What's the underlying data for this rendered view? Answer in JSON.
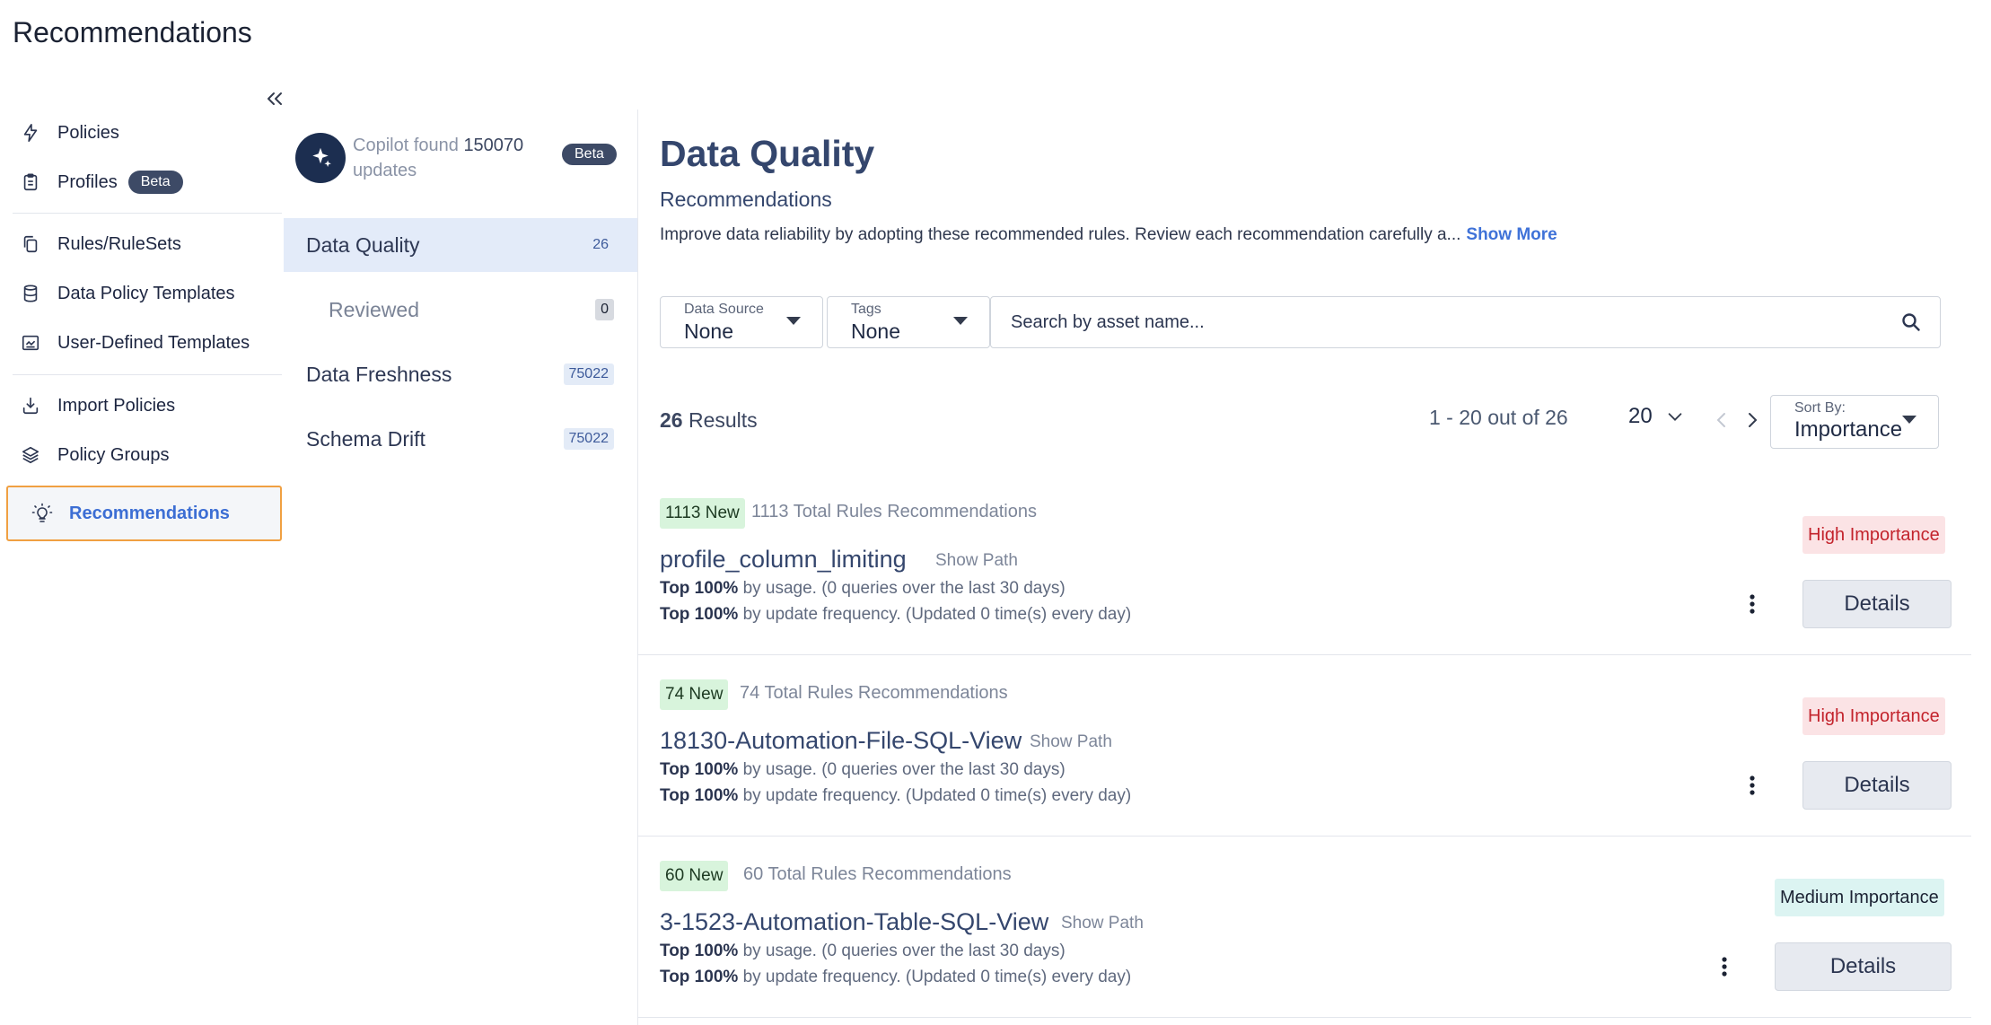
{
  "page": {
    "title": "Recommendations"
  },
  "sidebar": {
    "items": [
      {
        "label": "Policies",
        "icon": "lightning-icon"
      },
      {
        "label": "Profiles",
        "badge": "Beta",
        "icon": "clipboard-icon"
      },
      {
        "label": "Rules/RuleSets",
        "icon": "copy-icon"
      },
      {
        "label": "Data Policy Templates",
        "icon": "database-icon"
      },
      {
        "label": "User-Defined Templates",
        "icon": "template-icon"
      },
      {
        "label": "Import Policies",
        "icon": "import-icon"
      },
      {
        "label": "Policy Groups",
        "icon": "layers-icon"
      },
      {
        "label": "Recommendations",
        "icon": "lightbulb-icon",
        "active": true
      }
    ]
  },
  "copilot": {
    "prefix": "Copilot found",
    "count": "150070",
    "suffix": "updates",
    "badge": "Beta"
  },
  "categories": [
    {
      "label": "Data Quality",
      "count": "26",
      "active": true
    },
    {
      "label": "Reviewed",
      "count": "0"
    },
    {
      "label": "Data Freshness",
      "count": "75022"
    },
    {
      "label": "Schema Drift",
      "count": "75022"
    }
  ],
  "main": {
    "title": "Data Quality",
    "subtitle": "Recommendations",
    "description": "Improve data reliability by adopting these recommended rules. Review each recommendation carefully a...",
    "show_more": "Show More"
  },
  "filters": {
    "data_source": {
      "label": "Data Source",
      "value": "None"
    },
    "tags": {
      "label": "Tags",
      "value": "None"
    },
    "search_placeholder": "Search by asset name..."
  },
  "results": {
    "count": "26",
    "label": "Results",
    "range": "1 - 20 out of 26",
    "per_page": "20",
    "sort_label": "Sort By:",
    "sort_value": "Importance"
  },
  "cards": [
    {
      "new": "1113 New",
      "total": "1113 Total Rules Recommendations",
      "name": "profile_column_limiting",
      "show_path": "Show Path",
      "usage_bold": "Top 100%",
      "usage_text": "by usage. (0 queries over the last 30 days)",
      "freq_bold": "Top 100%",
      "freq_text": "by update frequency. (Updated 0 time(s) every day)",
      "importance": "High Importance",
      "details": "Details"
    },
    {
      "new": "74 New",
      "total": "74 Total Rules Recommendations",
      "name": "18130-Automation-File-SQL-View",
      "show_path": "Show Path",
      "usage_bold": "Top 100%",
      "usage_text": "by usage. (0 queries over the last 30 days)",
      "freq_bold": "Top 100%",
      "freq_text": "by update frequency. (Updated 0 time(s) every day)",
      "importance": "High Importance",
      "details": "Details"
    },
    {
      "new": "60 New",
      "total": "60 Total Rules Recommendations",
      "name": "3-1523-Automation-Table-SQL-View",
      "show_path": "Show Path",
      "usage_bold": "Top 100%",
      "usage_text": "by usage. (0 queries over the last 30 days)",
      "freq_bold": "Top 100%",
      "freq_text": "by update frequency. (Updated 0 time(s) every day)",
      "importance": "Medium Importance",
      "details": "Details"
    }
  ],
  "colors": {
    "accent": "#3f72d8",
    "active_outline": "#f0a042",
    "high_importance": "#c3232c",
    "new_badge_bg": "#d8f4dc"
  }
}
